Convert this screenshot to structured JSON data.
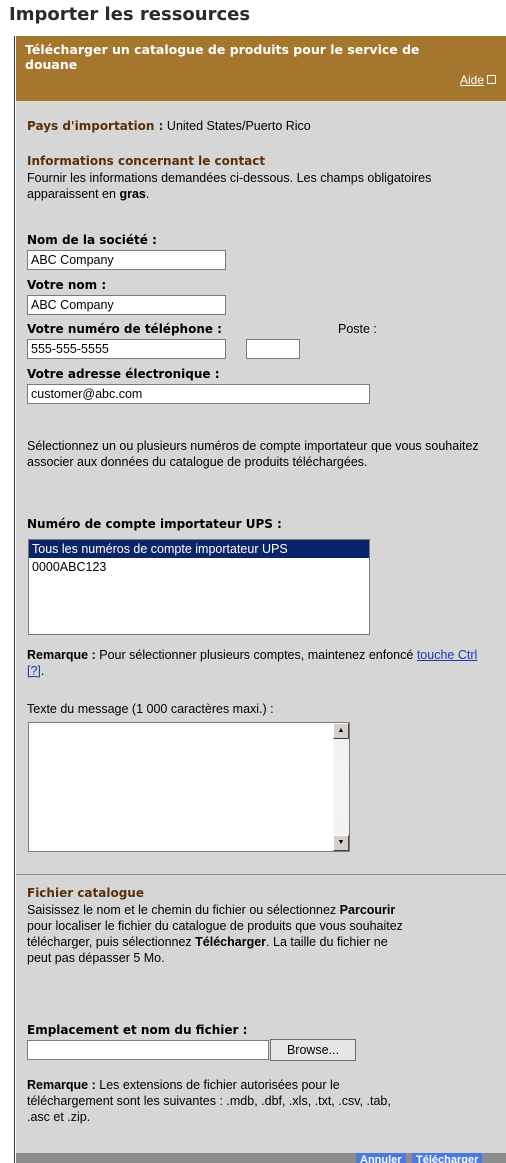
{
  "page": {
    "title": "Importer les ressources"
  },
  "panel": {
    "title": "Télécharger un catalogue de produits pour le service de douane",
    "help_link": "Aide"
  },
  "import_country": {
    "label": "Pays d'importation :",
    "value": "United States/Puerto Rico"
  },
  "contact": {
    "heading": "Informations concernant le contact",
    "instructions_prefix": "Fournir les informations demandées ci-dessous. Les champs obligatoires apparaissent en",
    "instructions_bold": "gras",
    "instructions_suffix": ".",
    "company_label": "Nom de la société :",
    "company_value": "ABC Company",
    "name_label": "Votre nom :",
    "name_value": "ABC Company",
    "phone_label": "Votre numéro de téléphone :",
    "phone_value": "555-555-5555",
    "ext_label": "Poste :",
    "ext_value": "",
    "email_label": "Votre adresse électronique :",
    "email_value": "customer@abc.com"
  },
  "accounts": {
    "instructions": "Sélectionnez un ou plusieurs numéros de compte importateur que vous souhaitez associer aux données du catalogue de produits téléchargées.",
    "label": "Numéro de compte importateur UPS :",
    "options": [
      "Tous les numéros de compte importateur UPS",
      "0000ABC123"
    ],
    "note_bold": "Remarque :",
    "note_text": "Pour sélectionner plusieurs comptes, maintenez enfoncé",
    "note_link": "touche Ctrl [?]",
    "note_end": "."
  },
  "message": {
    "label": "Texte du message (1 000 caractères maxi.) :",
    "value": ""
  },
  "catalog": {
    "heading": "Fichier catalogue",
    "line1_a": "Saisissez le nom et le chemin du fichier ou sélectionnez",
    "line1_b": "Parcourir",
    "line2": "pour localiser le fichier du catalogue de produits que vous souhaitez",
    "line3_a": "télécharger, puis sélectionnez",
    "line3_b": "Télécharger",
    "line3_c": ". La taille du fichier ne",
    "line4": "peut pas dépasser 5 Mo.",
    "file_label": "Emplacement et nom du fichier :",
    "file_value": "",
    "browse_label": "Browse...",
    "note_bold": "Remarque :",
    "note_line1": "Les extensions de fichier autorisées pour le",
    "note_line2": "téléchargement sont les suivantes : .mdb, .dbf, .xls, .txt, .csv, .tab,",
    "note_line3": ".asc et .zip."
  },
  "footer": {
    "cancel_label": "Annuler",
    "upload_label": "Télécharger"
  },
  "colors": {
    "header_bg": "#a5762e",
    "panel_bg": "#d6d6d6",
    "heading_text": "#5a2f0a",
    "selection": "#0a246a",
    "footer_button": "#4a7ae0"
  },
  "icons": {
    "help": "external-link-icon",
    "scroll_up": "scroll-up-arrow-icon",
    "scroll_down": "scroll-down-arrow-icon"
  }
}
